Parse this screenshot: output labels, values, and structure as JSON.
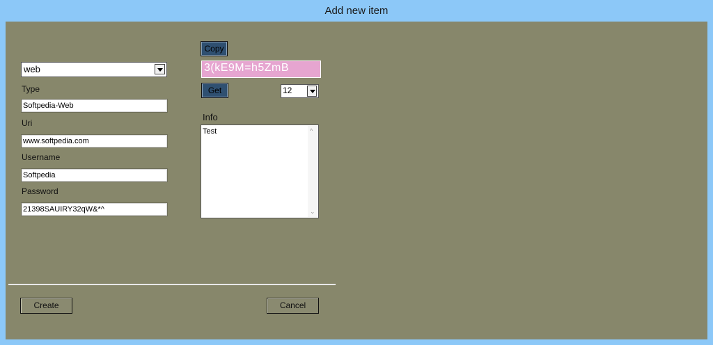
{
  "window": {
    "title": "Add new item"
  },
  "form": {
    "type_select_value": "web",
    "type_label": "Type",
    "type_value": "Softpedia-Web",
    "uri_label": "Uri",
    "uri_value": "www.softpedia.com",
    "username_label": "Username",
    "username_value": "Softpedia",
    "password_label": "Password",
    "password_value": "21398SAUIRY32qW&*^"
  },
  "generator": {
    "copy_label": "Copy",
    "generated_password": "3(kE9M=h5ZmB",
    "get_label": "Get",
    "length_value": "12"
  },
  "info": {
    "label": "Info",
    "text": "Test"
  },
  "actions": {
    "create_label": "Create",
    "cancel_label": "Cancel"
  },
  "colors": {
    "titlebar": "#8cc8f8",
    "client_bg": "#87876b",
    "generated_bg": "#e6a5d0",
    "dark_button": "#2f5071"
  }
}
